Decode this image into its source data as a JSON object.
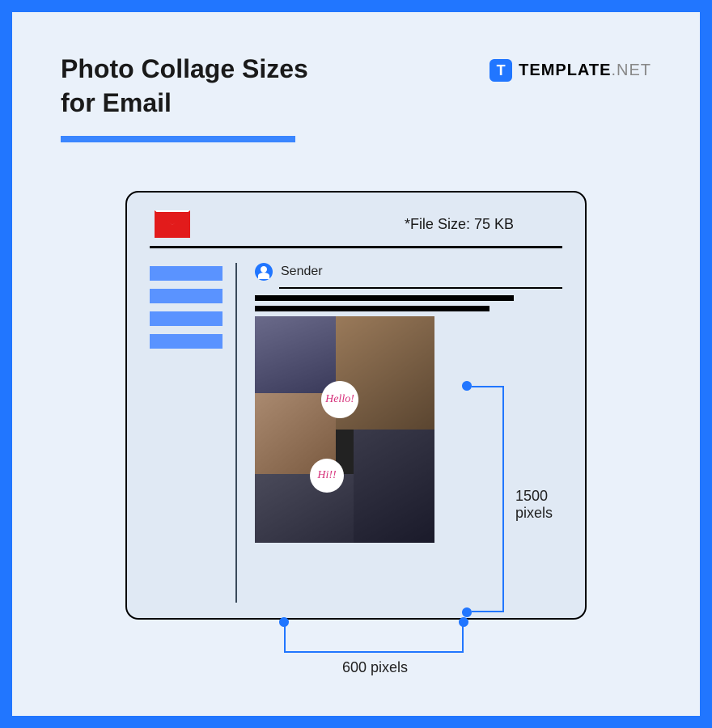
{
  "title_line1": "Photo Collage Sizes",
  "title_line2": "for Email",
  "brand": {
    "icon": "T",
    "text": "TEMPLATE",
    "suffix": ".NET"
  },
  "filesize_label": "*File Size: 75 KB",
  "sender_label": "Sender",
  "bubbles": {
    "b1": "Hello!",
    "b2": "Hi!!"
  },
  "dimensions": {
    "height": "1500 pixels",
    "width": "600 pixels"
  }
}
